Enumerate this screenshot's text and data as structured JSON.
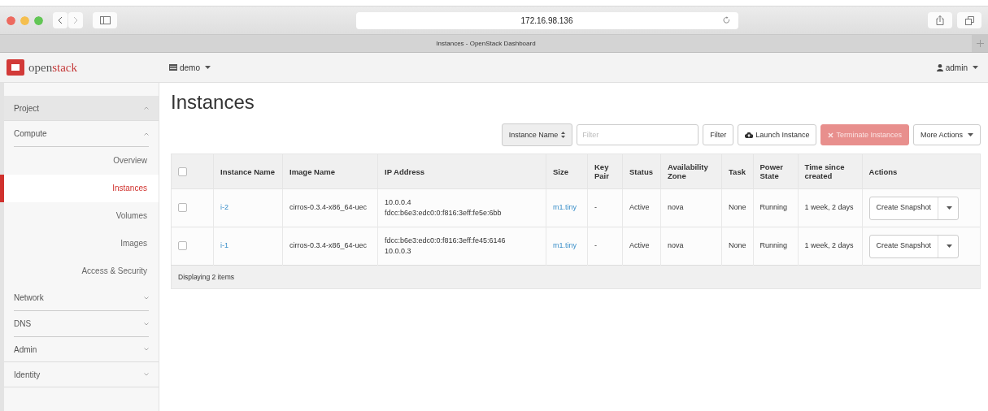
{
  "browser": {
    "address": "172.16.98.136",
    "tab_title": "Instances - OpenStack Dashboard"
  },
  "header": {
    "logo_text_light": "open",
    "logo_text_bold": "stack",
    "project_menu": "demo",
    "user_menu": "admin"
  },
  "sidebar": {
    "sections": [
      {
        "label": "Project",
        "expanded": true,
        "children": [
          {
            "label": "Compute",
            "expanded": true,
            "children": [
              {
                "label": "Overview",
                "selected": false
              },
              {
                "label": "Instances",
                "selected": true
              },
              {
                "label": "Volumes",
                "selected": false
              },
              {
                "label": "Images",
                "selected": false
              },
              {
                "label": "Access & Security",
                "selected": false
              }
            ]
          },
          {
            "label": "Network",
            "expanded": false
          },
          {
            "label": "DNS",
            "expanded": false
          }
        ]
      },
      {
        "label": "Admin",
        "expanded": false
      },
      {
        "label": "Identity",
        "expanded": false
      }
    ]
  },
  "page_title": "Instances",
  "toolbar": {
    "filter_field_select": "Instance Name",
    "filter_placeholder": "Filter",
    "filter_button": "Filter",
    "launch_button": "Launch Instance",
    "terminate_button": {
      "label": "Terminate Instances",
      "disabled": true
    },
    "more_button": "More Actions"
  },
  "table": {
    "select_all_checked": false,
    "columns": [
      "Instance Name",
      "Image Name",
      "IP Address",
      "Size",
      "Key Pair",
      "Status",
      "Availability Zone",
      "Task",
      "Power State",
      "Time since created",
      "Actions"
    ],
    "rows": [
      {
        "checked": false,
        "instance_name": "i-2",
        "image_name": "cirros-0.3.4-x86_64-uec",
        "ip_addresses": [
          "10.0.0.4",
          "fdcc:b6e3:edc0:0:f816:3eff:fe5e:6bb"
        ],
        "size": "m1.tiny",
        "key_pair": "-",
        "status": "Active",
        "availability_zone": "nova",
        "task": "None",
        "power_state": "Running",
        "time_since_created": "1 week, 2 days",
        "action": "Create Snapshot"
      },
      {
        "checked": false,
        "instance_name": "i-1",
        "image_name": "cirros-0.3.4-x86_64-uec",
        "ip_addresses": [
          "fdcc:b6e3:edc0:0:f816:3eff:fe45:6146",
          "10.0.0.3"
        ],
        "size": "m1.tiny",
        "key_pair": "-",
        "status": "Active",
        "availability_zone": "nova",
        "task": "None",
        "power_state": "Running",
        "time_since_created": "1 week, 2 days",
        "action": "Create Snapshot"
      }
    ],
    "footer": "Displaying 2 items"
  }
}
